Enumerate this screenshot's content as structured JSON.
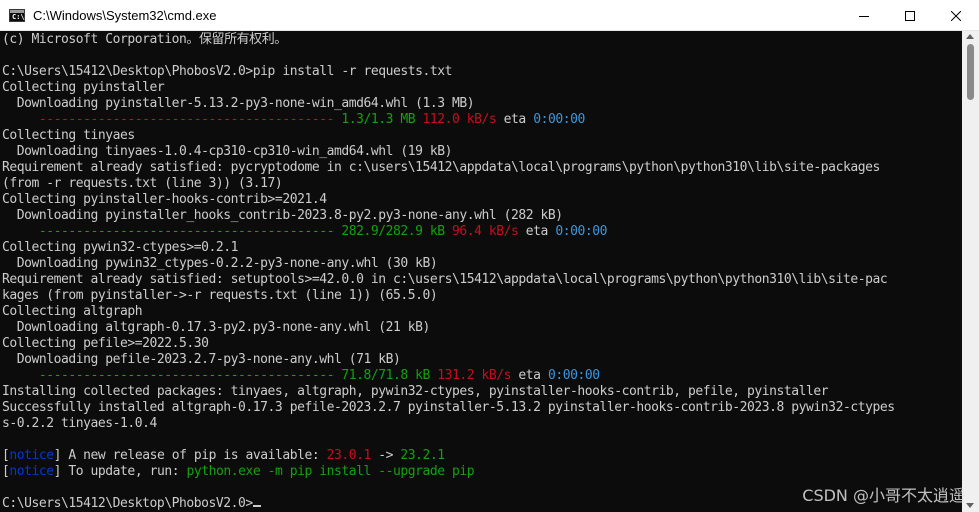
{
  "window": {
    "title": "C:\\Windows\\System32\\cmd.exe",
    "icon": "cmd-icon"
  },
  "controls": {
    "minimize": "minimize-icon",
    "maximize": "maximize-icon",
    "close": "close-icon"
  },
  "console": {
    "l1": "(c) Microsoft Corporation。保留所有权利。",
    "l2": "",
    "l3": "C:\\Users\\15412\\Desktop\\PhobosV2.0>pip install -r requests.txt",
    "l4": "Collecting pyinstaller",
    "l5": "  Downloading pyinstaller-5.13.2-py3-none-win_amd64.whl (1.3 MB)",
    "l6": {
      "bar": "     ---------------------------------------- ",
      "size": "1.3/1.3 MB",
      "speed": "112.0 kB/s",
      "eta_label": "eta",
      "eta": "0:00:00"
    },
    "l7": "Collecting tinyaes",
    "l8": "  Downloading tinyaes-1.0.4-cp310-cp310-win_amd64.whl (19 kB)",
    "l9": "Requirement already satisfied: pycryptodome in c:\\users\\15412\\appdata\\local\\programs\\python\\python310\\lib\\site-packages",
    "l10": "(from -r requests.txt (line 3)) (3.17)",
    "l11": "Collecting pyinstaller-hooks-contrib>=2021.4",
    "l12": "  Downloading pyinstaller_hooks_contrib-2023.8-py2.py3-none-any.whl (282 kB)",
    "l13": {
      "bar": "     ---------------------------------------- ",
      "size": "282.9/282.9 kB",
      "speed": "96.4 kB/s",
      "eta_label": "eta",
      "eta": "0:00:00"
    },
    "l14": "Collecting pywin32-ctypes>=0.2.1",
    "l15": "  Downloading pywin32_ctypes-0.2.2-py3-none-any.whl (30 kB)",
    "l16": "Requirement already satisfied: setuptools>=42.0.0 in c:\\users\\15412\\appdata\\local\\programs\\python\\python310\\lib\\site-pac",
    "l17": "kages (from pyinstaller->-r requests.txt (line 1)) (65.5.0)",
    "l18": "Collecting altgraph",
    "l19": "  Downloading altgraph-0.17.3-py2.py3-none-any.whl (21 kB)",
    "l20": "Collecting pefile>=2022.5.30",
    "l21": "  Downloading pefile-2023.2.7-py3-none-any.whl (71 kB)",
    "l22": {
      "bar": "     ---------------------------------------- ",
      "size": "71.8/71.8 kB",
      "speed": "131.2 kB/s",
      "eta_label": "eta",
      "eta": "0:00:00"
    },
    "l23": "Installing collected packages: tinyaes, altgraph, pywin32-ctypes, pyinstaller-hooks-contrib, pefile, pyinstaller",
    "l24": "Successfully installed altgraph-0.17.3 pefile-2023.2.7 pyinstaller-5.13.2 pyinstaller-hooks-contrib-2023.8 pywin32-ctypes",
    "l25": "s-0.2.2 tinyaes-1.0.4",
    "l26": "",
    "l27": {
      "open": "[",
      "tag": "notice",
      "close": "]",
      "text": " A new release of pip is available: ",
      "old": "23.0.1",
      "arrow": " -> ",
      "new": "23.2.1"
    },
    "l28": {
      "open": "[",
      "tag": "notice",
      "close": "]",
      "text": " To update, run: ",
      "cmd": "python.exe -m pip install --upgrade pip"
    },
    "l29": "",
    "l30": "C:\\Users\\15412\\Desktop\\PhobosV2.0>"
  },
  "watermark": "CSDN @小哥不太逍遥",
  "colors": {
    "green": "#13a10e",
    "red": "#c50f1f",
    "cyan": "#3a96dd",
    "blue": "#0037da",
    "text": "#cccccc",
    "bg": "#0c0c0c"
  }
}
